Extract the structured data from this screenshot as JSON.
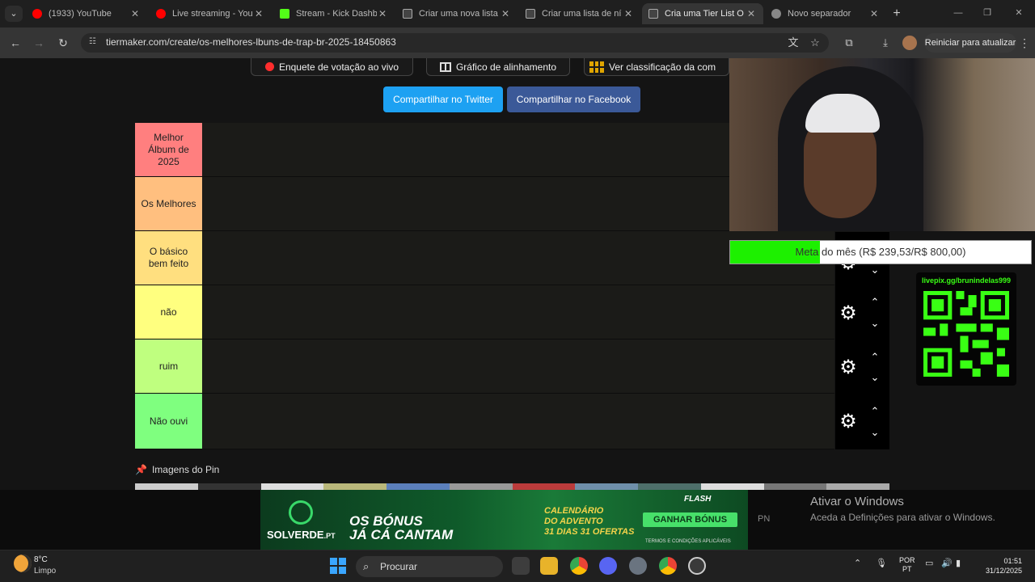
{
  "browser": {
    "tabs": [
      {
        "title": "(1933) YouTube",
        "icon": "youtube-icon",
        "active": false
      },
      {
        "title": "Live streaming - You",
        "icon": "youtube-icon",
        "active": false
      },
      {
        "title": "Stream - Kick Dashb",
        "icon": "kick-icon",
        "active": false
      },
      {
        "title": "Criar uma nova lista",
        "icon": "tiermaker-icon",
        "active": false
      },
      {
        "title": "Criar uma lista de ní",
        "icon": "tiermaker-icon",
        "active": false
      },
      {
        "title": "Cria uma Tier List O",
        "icon": "tiermaker-icon",
        "active": true
      },
      {
        "title": "Novo separador",
        "icon": "chrome-icon",
        "active": false
      }
    ],
    "url": "tiermaker.com/create/os-melhores-lbuns-de-trap-br-2025-18450863",
    "relaunch_label": "Reiniciar para atualizar"
  },
  "page": {
    "top_buttons": {
      "live_poll": "Enquete de votação ao vivo",
      "alignment_chart": "Gráfico de alinhamento",
      "view_ranking": "Ver classificação da com"
    },
    "share": {
      "twitter": "Compartilhar no Twitter",
      "facebook": "Compartilhar no Facebook"
    },
    "tiers": [
      {
        "label": "Melhor Álbum de 2025",
        "color": "#ff7f7f"
      },
      {
        "label": "Os Melhores",
        "color": "#ffbf7f"
      },
      {
        "label": "O básico bem feito",
        "color": "#ffdf7f"
      },
      {
        "label": "não",
        "color": "#ffff7f"
      },
      {
        "label": "ruim",
        "color": "#bfff7f"
      },
      {
        "label": "Não ouvi",
        "color": "#7fff7f"
      }
    ],
    "pinned_images_title": "Imagens do Pin"
  },
  "overlay": {
    "goal_text": "Meta do mês (R$ 239,53/R$ 800,00)",
    "goal_current": 239.53,
    "goal_target": 800.0,
    "qr_title": "livepix.gg/brunindelas999"
  },
  "ad": {
    "brand": "SOLVERDE",
    "brand_suffix": ".PT",
    "headline_1": "OS BÓNUS",
    "headline_2": "JÁ CÁ CANTAM",
    "calendar_1": "CALENDÁRIO",
    "calendar_2": "DO ADVENTO",
    "calendar_3": "31 DIAS 31 OFERTAS",
    "cta": "GANHAR BÓNUS",
    "terms": "TERMOS E CONDIÇÕES APLICÁVEIS",
    "flash": "FLASH",
    "right_tag": "PN"
  },
  "windows_watermark": {
    "title": "Ativar o Windows",
    "subtitle": "Aceda a Definições para ativar o Windows."
  },
  "taskbar": {
    "weather_temp": "8°C",
    "weather_desc": "Limpo",
    "search_placeholder": "Procurar",
    "lang_1": "POR",
    "lang_2": "PT",
    "time": "01:51",
    "date": "31/12/2025"
  }
}
